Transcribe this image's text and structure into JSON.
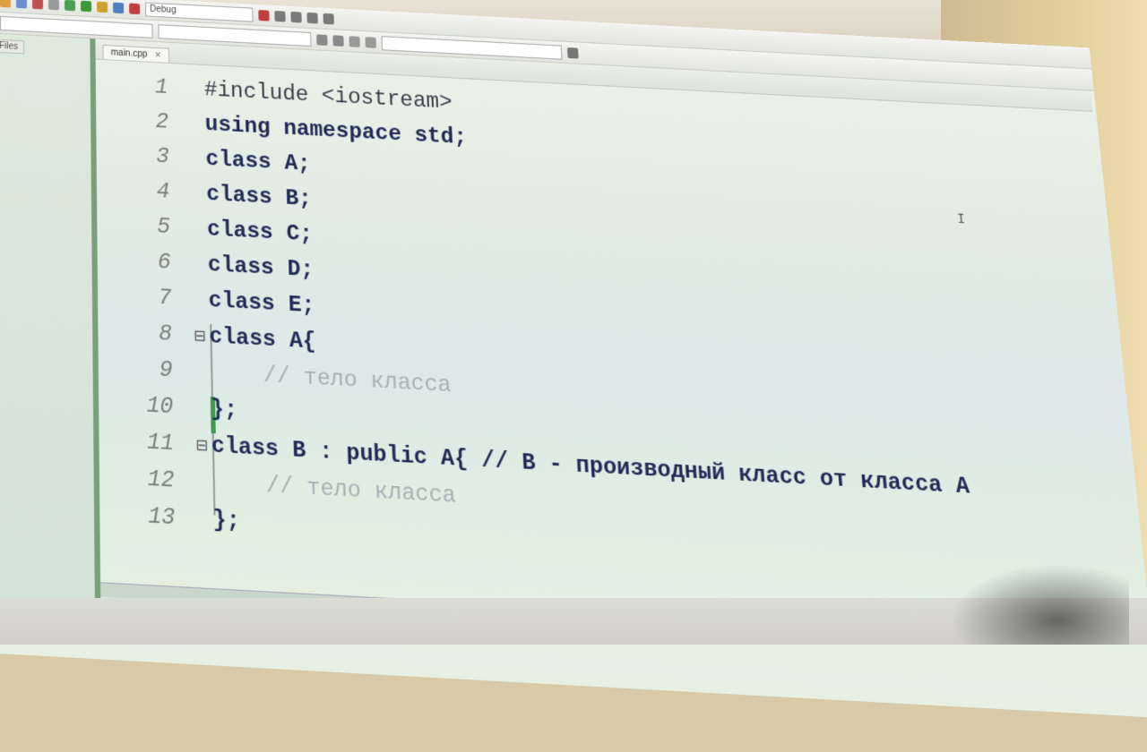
{
  "toolbar": {
    "build_target": "Debug"
  },
  "side_panel": {
    "tabs": [
      "",
      "Files"
    ]
  },
  "editor": {
    "file_tab": "main.cpp",
    "lines": [
      {
        "num": "1",
        "text": "#include <iostream>"
      },
      {
        "num": "2",
        "text": "using namespace std;"
      },
      {
        "num": "3",
        "text": "class A;"
      },
      {
        "num": "4",
        "text": "class B;"
      },
      {
        "num": "5",
        "text": "class C;"
      },
      {
        "num": "6",
        "text": "class D;"
      },
      {
        "num": "7",
        "text": "class E;"
      },
      {
        "num": "8",
        "text": "class A{"
      },
      {
        "num": "9",
        "text": "    // тело класса"
      },
      {
        "num": "10",
        "text": "};"
      },
      {
        "num": "11",
        "text": "class B : public A{ // B - производный класс от класса A"
      },
      {
        "num": "12",
        "text": "    // тело класса"
      },
      {
        "num": "13",
        "text": "};"
      }
    ]
  },
  "colors": {
    "accent": "#3e9c4a",
    "keyword": "#1f2a55",
    "comment": "#a9b0b4"
  }
}
